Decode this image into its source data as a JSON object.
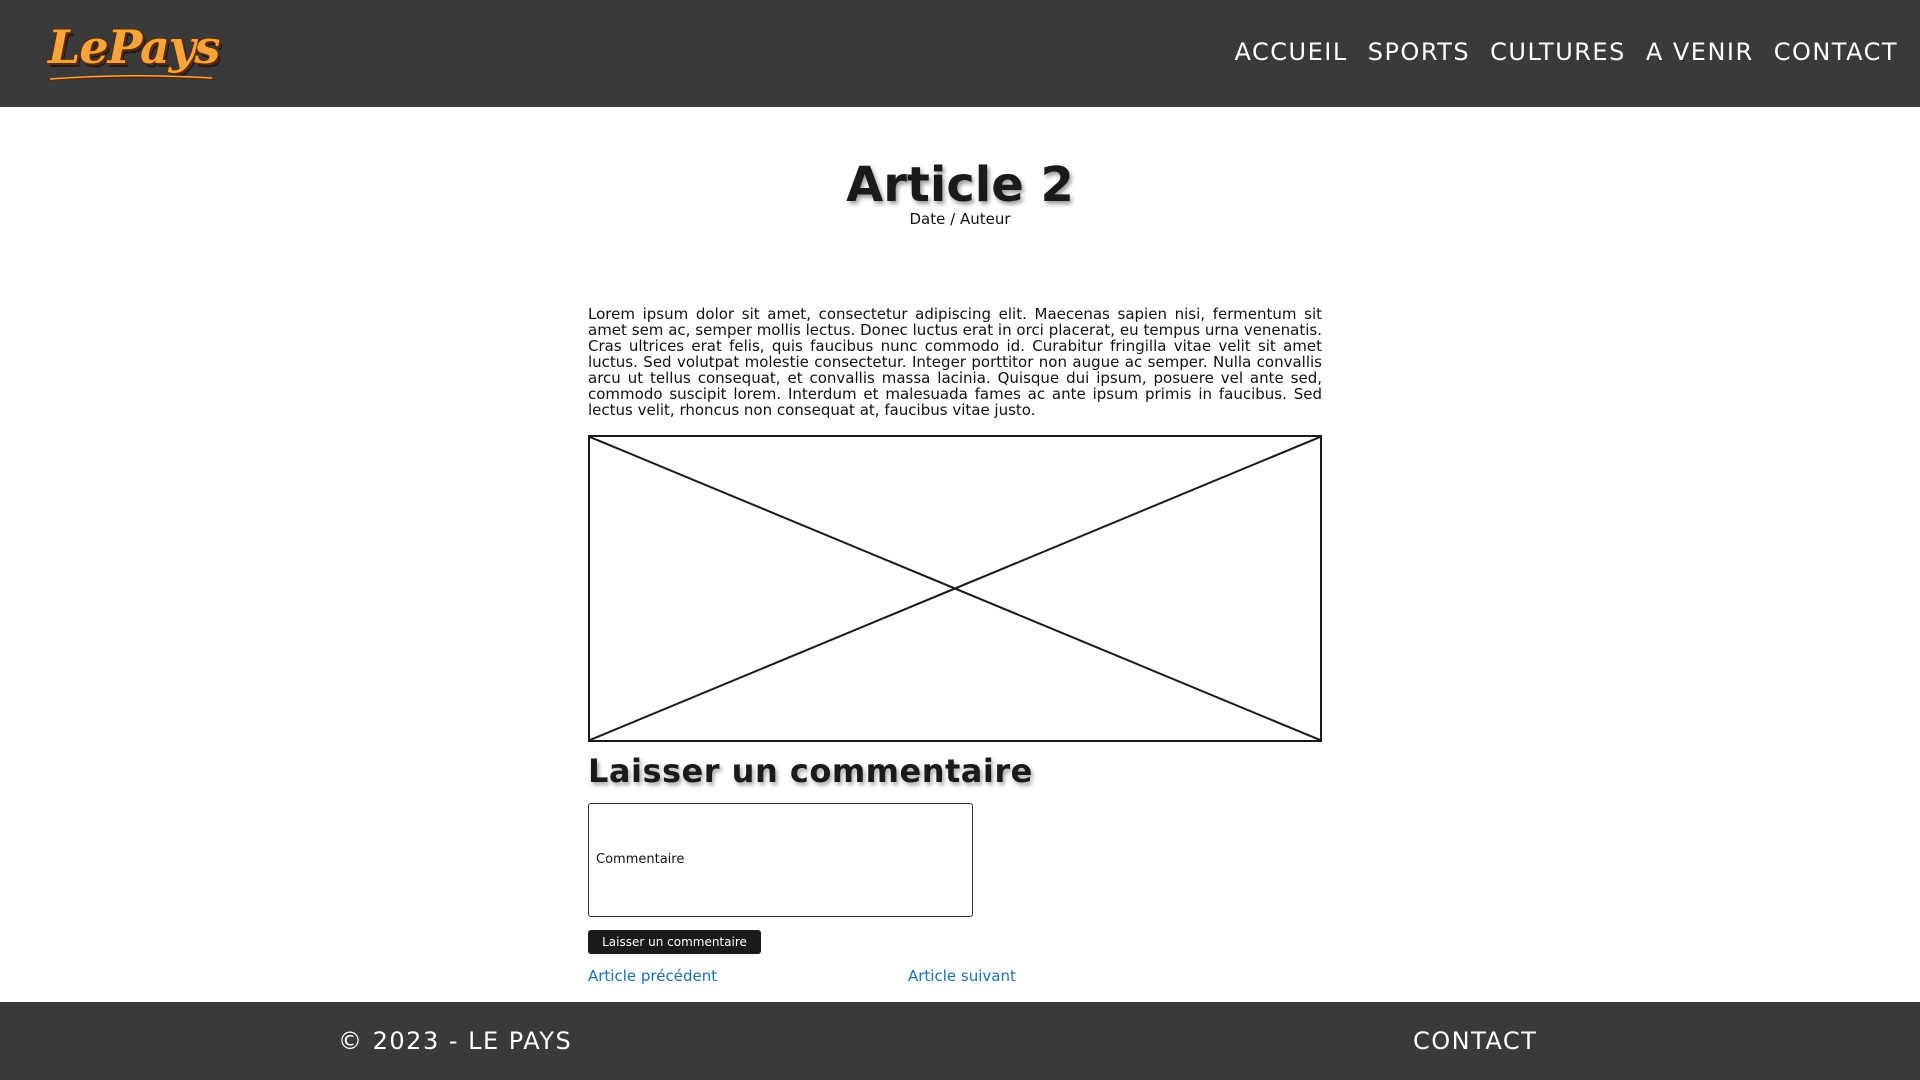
{
  "header": {
    "logo_text": "LePays",
    "nav": [
      {
        "label": "ACCUEIL"
      },
      {
        "label": "SPORTS"
      },
      {
        "label": "CULTURES"
      },
      {
        "label": "A VENIR"
      },
      {
        "label": "CONTACT"
      }
    ]
  },
  "article": {
    "title": "Article 2",
    "meta": "Date / Auteur",
    "body": "Lorem ipsum dolor sit amet, consectetur adipiscing elit. Maecenas sapien nisi, fermentum sit amet sem ac, semper mollis lectus. Donec luctus erat in orci placerat, eu tempus urna venenatis. Cras ultrices erat felis, quis faucibus nunc commodo id. Curabitur fringilla vitae velit sit amet luctus. Sed volutpat molestie consectetur. Integer porttitor non augue ac semper. Nulla convallis arcu ut tellus consequat, et convallis massa lacinia. Quisque dui ipsum, posuere vel ante sed, commodo suscipit lorem. Interdum et malesuada fames ac ante ipsum primis in faucibus. Sed lectus velit, rhoncus non consequat at, faucibus vitae justo."
  },
  "comment": {
    "title": "Laisser un commentaire",
    "placeholder": "Commentaire",
    "submit_label": "Laisser un commentaire"
  },
  "pagination": {
    "prev_label": "Article précédent",
    "next_label": "Article suivant"
  },
  "footer": {
    "copyright": "© 2023 - LE PAYS",
    "contact_label": "CONTACT"
  },
  "colors": {
    "header_bg": "#3a3a3a",
    "logo_accent": "#f7a53a",
    "link": "#1a6fb5",
    "button_bg": "#1a1a1a"
  }
}
